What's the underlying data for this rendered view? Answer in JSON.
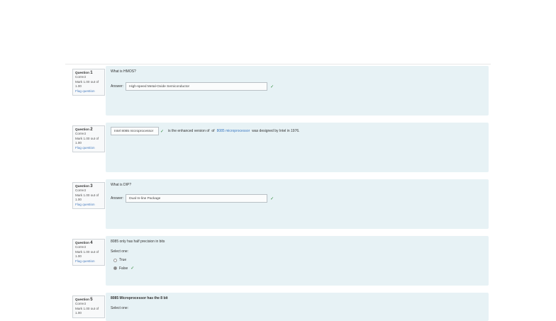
{
  "questions": [
    {
      "no": "1",
      "status": "Correct",
      "mark": "Mark 1.00 out of 1.00",
      "flag": "Flag question",
      "prompt": "What is HMOS?",
      "answer_label": "Answer:",
      "answer": "High-speed Metal-Oxide Semiconductor",
      "tick": "✓"
    },
    {
      "no": "2",
      "status": "Correct",
      "mark": "Mark 1.00 out of 1.00",
      "flag": "Flag question",
      "choice": "Intel 8085 microprocessor",
      "tick": "✓",
      "text_a": "is the enhanced version of",
      "text_b": "of",
      "link": "8085 microprocessor",
      "text_c": "was designed by Intel in 1976."
    },
    {
      "no": "3",
      "status": "Correct",
      "mark": "Mark 1.00 out of 1.00",
      "flag": "Flag question",
      "prompt": "What is DIP?",
      "answer_label": "Answer:",
      "answer": "Dual In-line Package",
      "tick": "✓"
    },
    {
      "no": "4",
      "status": "Correct",
      "mark": "Mark 1.00 out of 1.00",
      "flag": "Flag question",
      "prompt": "8085 only has half precision in bits",
      "select_one": "Select one:",
      "opt_true": "True",
      "opt_false": "False",
      "tick": "✓"
    },
    {
      "no": "5",
      "status": "Correct",
      "mark": "Mark 1.00 out of 1.00",
      "prompt": "8085 Microprocessor has the 8 bit",
      "select_one": "Select one:"
    }
  ],
  "question_word": "Question"
}
